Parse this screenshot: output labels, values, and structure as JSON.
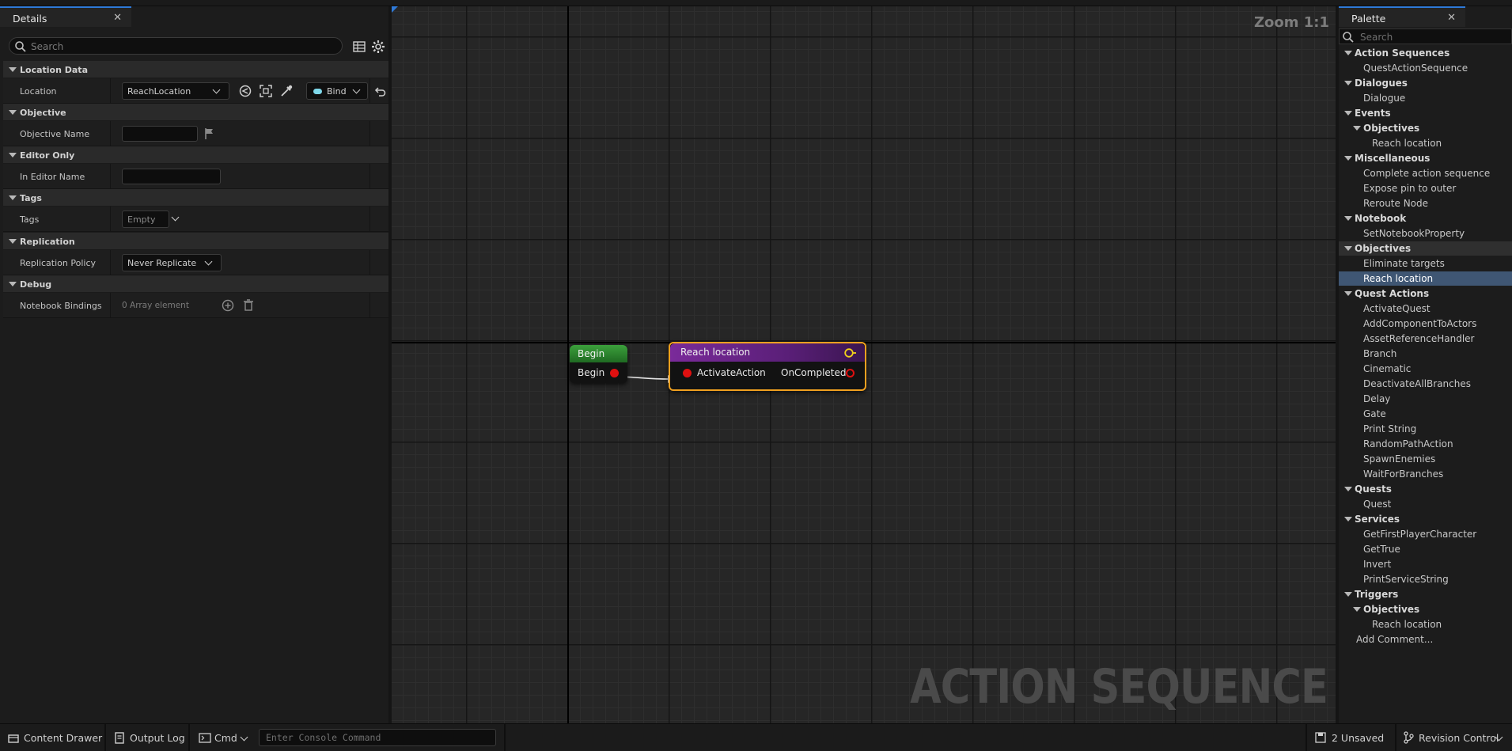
{
  "details": {
    "tab_title": "Details",
    "search_placeholder": "Search",
    "categories": {
      "location_data": "Location Data",
      "objective": "Objective",
      "editor_only": "Editor Only",
      "tags": "Tags",
      "replication": "Replication",
      "debug": "Debug"
    },
    "props": {
      "location_label": "Location",
      "location_value": "ReachLocation",
      "bind_label": "Bind",
      "objective_name_label": "Objective Name",
      "objective_name_value": "",
      "in_editor_name_label": "In Editor Name",
      "in_editor_name_value": "",
      "tags_label": "Tags",
      "tags_value": "Empty",
      "replication_policy_label": "Replication Policy",
      "replication_policy_value": "Never Replicate",
      "notebook_bindings_label": "Notebook Bindings",
      "notebook_bindings_value": "0 Array element"
    }
  },
  "graph": {
    "zoom_label": "Zoom 1:1",
    "watermark": "ACTION SEQUENCE",
    "begin_node": {
      "title": "Begin",
      "output_pin": "Begin",
      "header_color": "#1f7a2a"
    },
    "reach_node": {
      "title": "Reach location",
      "input_pin": "ActivateAction",
      "output_pin": "OnCompleted",
      "header_color": "#6b2a8c",
      "selection_color": "#f0a020"
    },
    "pin_color": "#e01010"
  },
  "palette": {
    "tab_title": "Palette",
    "search_placeholder": "Search",
    "items": [
      {
        "label": "Action Sequences",
        "kind": "cat"
      },
      {
        "label": "QuestActionSequence",
        "kind": "item"
      },
      {
        "label": "Dialogues",
        "kind": "cat"
      },
      {
        "label": "Dialogue",
        "kind": "item"
      },
      {
        "label": "Events",
        "kind": "cat"
      },
      {
        "label": "Objectives",
        "kind": "subcat"
      },
      {
        "label": "Reach location",
        "kind": "subitem"
      },
      {
        "label": "Miscellaneous",
        "kind": "cat"
      },
      {
        "label": "Complete action sequence",
        "kind": "item"
      },
      {
        "label": "Expose pin to outer",
        "kind": "item"
      },
      {
        "label": "Reroute Node",
        "kind": "item"
      },
      {
        "label": "Notebook",
        "kind": "cat"
      },
      {
        "label": "SetNotebookProperty",
        "kind": "item"
      },
      {
        "label": "Objectives",
        "kind": "cat",
        "state": "selcat"
      },
      {
        "label": "Eliminate targets",
        "kind": "item"
      },
      {
        "label": "Reach location",
        "kind": "item",
        "state": "sel"
      },
      {
        "label": "Quest Actions",
        "kind": "cat"
      },
      {
        "label": "ActivateQuest",
        "kind": "item"
      },
      {
        "label": "AddComponentToActors",
        "kind": "item"
      },
      {
        "label": "AssetReferenceHandler",
        "kind": "item"
      },
      {
        "label": "Branch",
        "kind": "item"
      },
      {
        "label": "Cinematic",
        "kind": "item"
      },
      {
        "label": "DeactivateAllBranches",
        "kind": "item"
      },
      {
        "label": "Delay",
        "kind": "item"
      },
      {
        "label": "Gate",
        "kind": "item"
      },
      {
        "label": "Print String",
        "kind": "item"
      },
      {
        "label": "RandomPathAction",
        "kind": "item"
      },
      {
        "label": "SpawnEnemies",
        "kind": "item"
      },
      {
        "label": "WaitForBranches",
        "kind": "item"
      },
      {
        "label": "Quests",
        "kind": "cat"
      },
      {
        "label": "Quest",
        "kind": "item"
      },
      {
        "label": "Services",
        "kind": "cat"
      },
      {
        "label": "GetFirstPlayerCharacter",
        "kind": "item"
      },
      {
        "label": "GetTrue",
        "kind": "item"
      },
      {
        "label": "Invert",
        "kind": "item"
      },
      {
        "label": "PrintServiceString",
        "kind": "item"
      },
      {
        "label": "Triggers",
        "kind": "cat"
      },
      {
        "label": "Objectives",
        "kind": "subcat"
      },
      {
        "label": "Reach location",
        "kind": "subitem"
      },
      {
        "label": "Add Comment...",
        "kind": "root"
      }
    ]
  },
  "bottombar": {
    "content_drawer": "Content Drawer",
    "output_log": "Output Log",
    "cmd": "Cmd",
    "console_placeholder": "Enter Console Command",
    "unsaved": "2 Unsaved",
    "revision_control": "Revision Control"
  },
  "colors": {
    "accent": "#2f7ad8",
    "selection": "#3f5673"
  }
}
